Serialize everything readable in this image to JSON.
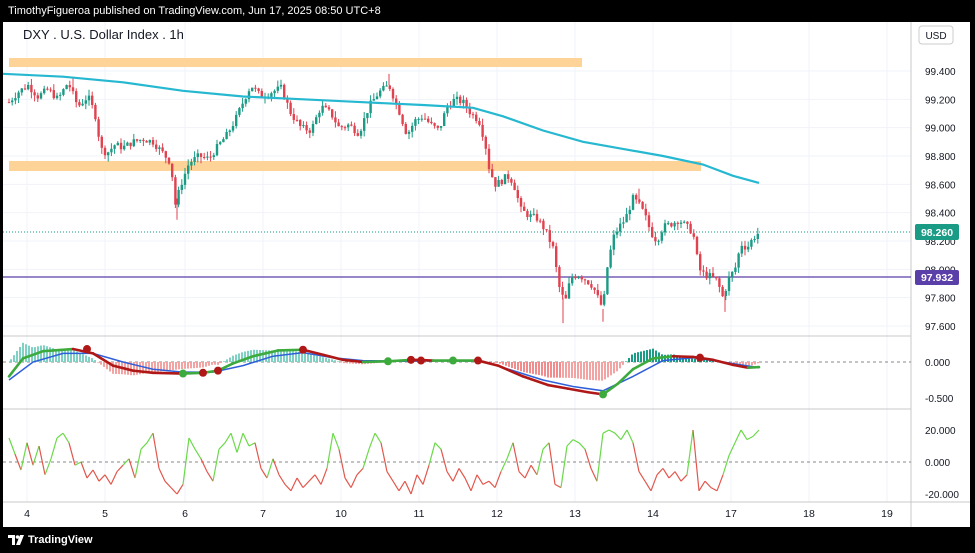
{
  "header": {
    "publisher_line": "TimothyFigueroa published on TradingView.com, Jun 17, 2025 08:50 UTC+8"
  },
  "footer": {
    "brand": "TradingView"
  },
  "chart": {
    "title": "DXY . U.S. Dollar Index . 1h",
    "currency": "USD",
    "last_price_label": "98.260",
    "level_label": "97.932",
    "price_ticks": [
      "99.400",
      "99.200",
      "99.000",
      "98.800",
      "98.600",
      "98.400",
      "98.200",
      "98.000",
      "97.800",
      "97.600"
    ],
    "macd_ticks": [
      "0.000",
      "-0.500"
    ],
    "osc_ticks": [
      "20.000",
      "0.000",
      "-20.000"
    ],
    "x_ticks": [
      "4",
      "5",
      "6",
      "7",
      "10",
      "11",
      "12",
      "13",
      "14",
      "17",
      "18",
      "19"
    ]
  },
  "chart_data": {
    "type": "candlestick",
    "title": "DXY . U.S. Dollar Index . 1h",
    "price_ylim": [
      97.55,
      99.55
    ],
    "ma_color": "#26b8d0",
    "up_color": "#1a9b86",
    "down_color": "#e0424f",
    "zones": [
      {
        "from": 99.45,
        "to": 99.5,
        "x_end_day": 12.9
      },
      {
        "from": 98.71,
        "to": 98.78,
        "x_end_day": 15.6
      }
    ],
    "horizontal_levels": [
      97.932
    ],
    "last_price": 98.26,
    "macd": {
      "ylim": [
        -0.65,
        0.25
      ],
      "zero": 0.0
    },
    "oscillator": {
      "ylim": [
        -25,
        25
      ],
      "levels": [
        20,
        0,
        -20
      ]
    }
  }
}
